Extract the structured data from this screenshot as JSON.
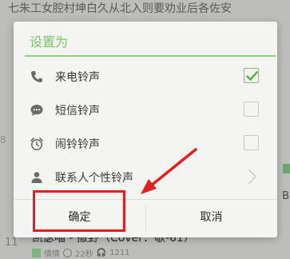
{
  "background": {
    "top_text": "七朱工女腔村坤白久从北入则要劝业后各佐安",
    "left_number": "8",
    "right_char": "B",
    "song": {
      "number": "11",
      "title": "凯瑟喵 - 撒野（Cover：歇-61）",
      "author": "情情",
      "duration": "22秒",
      "plays": "1211"
    }
  },
  "dialog": {
    "title": "设置为",
    "options": [
      {
        "label": "来电铃声",
        "icon": "phone-icon",
        "checked": true
      },
      {
        "label": "短信铃声",
        "icon": "message-icon",
        "checked": false
      },
      {
        "label": "闹铃铃声",
        "icon": "alarm-clock-icon",
        "checked": false
      },
      {
        "label": "联系人个性铃声",
        "icon": "contact-person-icon",
        "has_arrow": true
      }
    ],
    "ok_label": "确定",
    "cancel_label": "取消"
  },
  "colors": {
    "accent": "#7cc46a",
    "annotation": "#e02020"
  }
}
